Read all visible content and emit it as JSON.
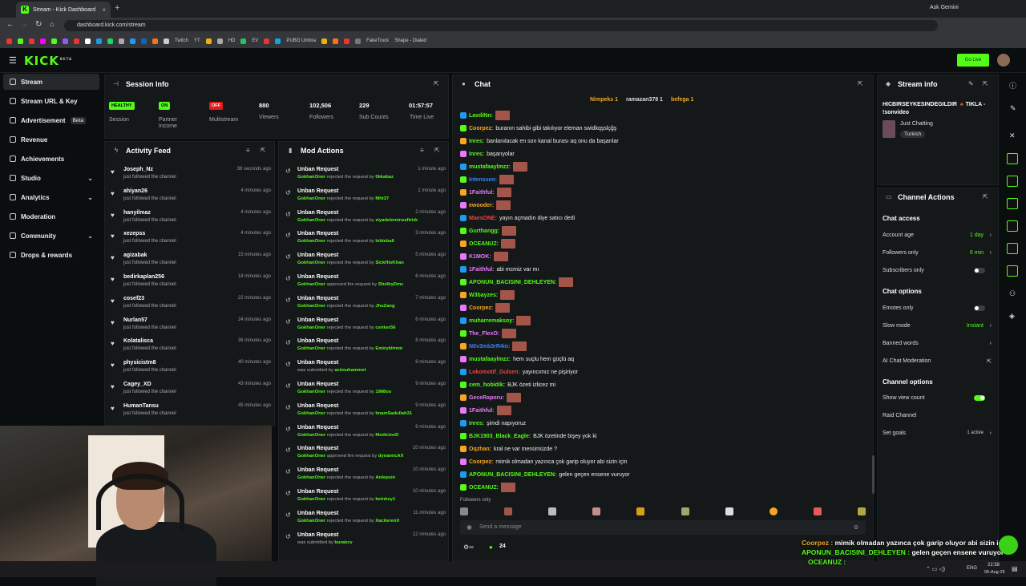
{
  "browser": {
    "tab_title": "Stream - Kick Dashboard",
    "url": "dashboard.kick.com/stream",
    "ask_gemini": "Ask Gemini",
    "bookmarks": [
      "Twitch",
      "YT",
      "HD",
      "EV",
      "PUBG Umbra",
      "FakeTruck",
      "Shape - Dialed"
    ]
  },
  "header": {
    "logo": "KICK",
    "logo_tag": "BETA",
    "go_live": "Go Live"
  },
  "sidebar": {
    "items": [
      {
        "label": "Stream",
        "active": true
      },
      {
        "label": "Stream URL & Key"
      },
      {
        "label": "Advertisement",
        "badge": "Beta"
      },
      {
        "label": "Revenue"
      },
      {
        "label": "Achievements"
      },
      {
        "label": "Studio",
        "chevron": true
      },
      {
        "label": "Analytics",
        "chevron": true
      },
      {
        "label": "Moderation"
      },
      {
        "label": "Community",
        "chevron": true
      },
      {
        "label": "Drops & rewards"
      }
    ]
  },
  "session": {
    "title": "Session Info",
    "stats": [
      {
        "badge": "HEALTHY",
        "label": "Session",
        "color": "#53fc18"
      },
      {
        "badge": "ON",
        "label": "Partner Income",
        "color": "#53fc18"
      },
      {
        "badge": "OFF",
        "label": "Multistream",
        "color": "#e21b1b"
      },
      {
        "value": "880",
        "label": "Viewers"
      },
      {
        "value": "102,506",
        "label": "Followers"
      },
      {
        "value": "229",
        "label": "Sub Counts"
      },
      {
        "value": "01:57:57",
        "label": "Time Live"
      }
    ]
  },
  "activity": {
    "title": "Activity Feed",
    "items": [
      {
        "name": "Joseph_Nz",
        "desc": "just followed the channel",
        "time": "38 seconds ago"
      },
      {
        "name": "ahiyan26",
        "desc": "just followed the channel",
        "time": "4 minutes ago"
      },
      {
        "name": "hanyilmaz",
        "desc": "just followed the channel",
        "time": "4 minutes ago"
      },
      {
        "name": "xezepss",
        "desc": "just followed the channel",
        "time": "4 minutes ago"
      },
      {
        "name": "agizabak",
        "desc": "just followed the channel",
        "time": "15 minutes ago"
      },
      {
        "name": "bedirkaplan256",
        "desc": "just followed the channel",
        "time": "18 minutes ago"
      },
      {
        "name": "cosef23",
        "desc": "just followed the channel",
        "time": "22 minutes ago"
      },
      {
        "name": "Nurlan57",
        "desc": "just followed the channel",
        "time": "24 minutes ago"
      },
      {
        "name": "Kolatalisca",
        "desc": "just followed the channel",
        "time": "38 minutes ago"
      },
      {
        "name": "physicistm8",
        "desc": "just followed the channel",
        "time": "40 minutes ago"
      },
      {
        "name": "Cagey_XD",
        "desc": "just followed the channel",
        "time": "43 minutes ago"
      },
      {
        "name": "HumanTansu",
        "desc": "just followed the channel",
        "time": "45 minutes ago"
      }
    ]
  },
  "mod": {
    "title": "Mod Actions",
    "items": [
      {
        "action": "Unban Request",
        "mod": "GokhanOner",
        "verb": "rejected the request by",
        "user": "0kkabaz",
        "time": "1 minute ago"
      },
      {
        "action": "Unban Request",
        "mod": "GokhanOner",
        "verb": "rejected the request by",
        "user": "Mht37",
        "time": "1 minute ago"
      },
      {
        "action": "Unban Request",
        "mod": "GokhanOner",
        "verb": "rejected the request by",
        "user": "ziyadeleminseftridr",
        "time": "2 minutes ago"
      },
      {
        "action": "Unban Request",
        "mod": "GokhanOner",
        "verb": "rejected the request by",
        "user": "lebtebali",
        "time": "3 minutes ago"
      },
      {
        "action": "Unban Request",
        "mod": "GokhanOner",
        "verb": "rejected the request by",
        "user": "SickHisKhan",
        "time": "5 minutes ago"
      },
      {
        "action": "Unban Request",
        "mod": "GokhanOner",
        "verb": "approved the request by",
        "user": "ShelbyDmc",
        "time": "6 minutes ago"
      },
      {
        "action": "Unban Request",
        "mod": "GokhanOner",
        "verb": "rejected the request by",
        "user": "JhuZang",
        "time": "7 minutes ago"
      },
      {
        "action": "Unban Request",
        "mod": "GokhanOner",
        "verb": "rejected the request by",
        "user": "cenker56",
        "time": "8 minutes ago"
      },
      {
        "action": "Unban Request",
        "mod": "GokhanOner",
        "verb": "rejected the request by",
        "user": "Emiryldrmm",
        "time": "8 minutes ago"
      },
      {
        "action": "Unban Request",
        "mod": "",
        "verb": "was submitted by",
        "user": "acimuhammet",
        "time": "8 minutes ago"
      },
      {
        "action": "Unban Request",
        "mod": "GokhanOner",
        "verb": "rejected the request by",
        "user": "1988oo",
        "time": "9 minutes ago"
      },
      {
        "action": "Unban Request",
        "mod": "GokhanOner",
        "verb": "rejected the request by",
        "user": "ImamSadullah31",
        "time": "9 minutes ago"
      },
      {
        "action": "Unban Request",
        "mod": "GokhanOner",
        "verb": "rejected the request by",
        "user": "MedicineD",
        "time": "9 minutes ago"
      },
      {
        "action": "Unban Request",
        "mod": "GokhanOner",
        "verb": "approved the request by",
        "user": "dynamicAX",
        "time": "10 minutes ago"
      },
      {
        "action": "Unban Request",
        "mod": "GokhanOner",
        "verb": "rejected the request by",
        "user": "Antepsin",
        "time": "10 minutes ago"
      },
      {
        "action": "Unban Request",
        "mod": "GokhanOner",
        "verb": "rejected the request by",
        "user": "beinkey1",
        "time": "10 minutes ago"
      },
      {
        "action": "Unban Request",
        "mod": "GokhanOner",
        "verb": "rejected the request by",
        "user": "XaciterenX",
        "time": "11 minutes ago"
      },
      {
        "action": "Unban Request",
        "mod": "",
        "verb": "was submitted by",
        "user": "burakcv",
        "time": "12 minutes ago"
      }
    ]
  },
  "chat": {
    "title": "Chat",
    "top_gifters": [
      "Nimpeks 1",
      "ramazan378 1",
      "befega 1"
    ],
    "messages": [
      {
        "user": "LavdiNn:",
        "color": "#53fc18",
        "text": "",
        "emote": true
      },
      {
        "user": "Coorpez:",
        "color": "#f5a623",
        "text": "buranın sahibi gibi takılıyor eleman swidkqşslçğş"
      },
      {
        "user": "Inres:",
        "color": "#53fc18",
        "text": "banlanılacak en son kanal burası aq onu da başarılar"
      },
      {
        "user": "Inres:",
        "color": "#53fc18",
        "text": "başarıyolar"
      },
      {
        "user": "mustafaaylmzz:",
        "color": "#53fc18",
        "text": "",
        "emote": true
      },
      {
        "user": "Intensseo:",
        "color": "#3b82f6",
        "text": "",
        "emote": true
      },
      {
        "user": "1Faithful:",
        "color": "#e879f9",
        "text": "",
        "emote": true
      },
      {
        "user": "ewooder:",
        "color": "#f5a623",
        "text": "",
        "emote": true
      },
      {
        "user": "MaesONE:",
        "color": "#ef4444",
        "text": "yayın açmadın diye satıcı dedi"
      },
      {
        "user": "Gurthangg:",
        "color": "#53fc18",
        "text": "",
        "emote": true
      },
      {
        "user": "OCEANUZ:",
        "color": "#53fc18",
        "text": "",
        "emote": true
      },
      {
        "user": "K1MOK:",
        "color": "#e879f9",
        "text": "",
        "emote": true
      },
      {
        "user": "1Faithful:",
        "color": "#e879f9",
        "text": "abi mcmiz var mı"
      },
      {
        "user": "APONUN_BACISINI_DEHLEYEN:",
        "color": "#53fc18",
        "text": "",
        "emote": true
      },
      {
        "user": "W3bayzes:",
        "color": "#53fc18",
        "text": "",
        "emote": true
      },
      {
        "user": "Coorpez:",
        "color": "#f5a623",
        "text": "",
        "emote": true
      },
      {
        "user": "muharremaksoy:",
        "color": "#53fc18",
        "text": "",
        "emote": true
      },
      {
        "user": "The_FlexO:",
        "color": "#e879f9",
        "text": "",
        "emote": true
      },
      {
        "user": "N0v3mb3rR4in:",
        "color": "#3b82f6",
        "text": "",
        "emote": true
      },
      {
        "user": "mustafaaylmzz:",
        "color": "#53fc18",
        "text": "hem suçlu hem güçlü aq"
      },
      {
        "user": "Lokomotif_Gulsen:",
        "color": "#ef4444",
        "text": "yayıncımız ne pişiriyor"
      },
      {
        "user": "cem_hobidik:",
        "color": "#53fc18",
        "text": "BJK özeti izlicez mi"
      },
      {
        "user": "GeceRaporu:",
        "color": "#e879f9",
        "text": "",
        "emote": true
      },
      {
        "user": "1Faithful:",
        "color": "#e879f9",
        "text": "",
        "emote": true
      },
      {
        "user": "Inres:",
        "color": "#53fc18",
        "text": "şimdi napıyoruz"
      },
      {
        "user": "BJK1903_Black_Eagle:",
        "color": "#53fc18",
        "text": "BJK özetinde bişey yok ki"
      },
      {
        "user": "Oqzhan:",
        "color": "#f5a623",
        "text": "kral ne var menümüzde ?"
      },
      {
        "user": "Coorpez:",
        "color": "#f5a623",
        "text": "mimik olmadan yazınca çok garip oluyor abi sizin için"
      },
      {
        "user": "APONUN_BACISINI_DEHLEYEN:",
        "color": "#53fc18",
        "text": "gelen geçen ensene vuruyor"
      },
      {
        "user": "OCEANUZ:",
        "color": "#53fc18",
        "text": "",
        "emote": true
      }
    ],
    "followers_only": "Followers only",
    "input_placeholder": "Send a message",
    "points": "24"
  },
  "stream_info": {
    "title": "Stream info",
    "stream_title": "HICBIRSEYKESINDEGILDIR 🔺TIKLA - !sonvideo",
    "category": "Just Chatting",
    "tag": "Turkish"
  },
  "channel_actions": {
    "title": "Channel Actions",
    "chat_access": "Chat access",
    "account_age": {
      "label": "Account age",
      "value": "1 day"
    },
    "followers_only": {
      "label": "Followers only",
      "value": "6 min"
    },
    "subscribers_only": {
      "label": "Subscribers only",
      "on": false
    },
    "chat_options": "Chat options",
    "emotes_only": {
      "label": "Emotes only",
      "on": false
    },
    "slow_mode": {
      "label": "Slow mode",
      "value": "Instant"
    },
    "banned_words": "Banned words",
    "ai_mod": "AI Chat Moderation",
    "channel_options": "Channel options",
    "show_view_count": {
      "label": "Show view count",
      "on": true
    },
    "raid_channel": "Raid Channel",
    "set_goals": {
      "label": "Set goals",
      "value": "1 active"
    }
  },
  "overlay": {
    "line1_user": "Coorpez :",
    "line1_text": "mimik olmadan yazınca çok garip oluyor abi sizin için",
    "line2_user": "APONUN_BACISINI_DEHLEYEN :",
    "line2_text": "gelen geçen ensene vuruyor",
    "line3_user": "OCEANUZ :"
  },
  "taskbar": {
    "lang": "ENG",
    "time": "22:58",
    "date": "05-Aug-25"
  }
}
